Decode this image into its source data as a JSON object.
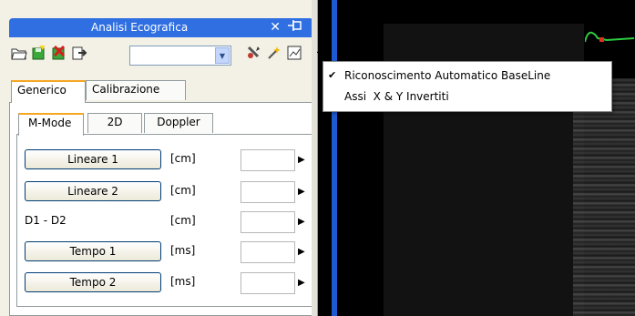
{
  "panel": {
    "title": "Analisi Ecografica",
    "close_glyph": "✕",
    "pin_glyph": "⊣▭"
  },
  "toolbar": {
    "icons": [
      "open-folder-icon",
      "save-green-icon",
      "delete-red-icon",
      "export-icon",
      "tools-icon",
      "wand-icon",
      "chart-icon"
    ],
    "combo_value": ""
  },
  "tabs": {
    "outer": [
      {
        "label": "Generico",
        "active": true
      },
      {
        "label": "Calibrazione",
        "active": false
      }
    ],
    "inner": [
      {
        "label": "M-Mode",
        "active": true
      },
      {
        "label": "2D",
        "active": false
      },
      {
        "label": "Doppler",
        "active": false
      }
    ]
  },
  "measurements": [
    {
      "label": "Lineare 1",
      "unit": "[cm]",
      "is_button": true,
      "value": ""
    },
    {
      "label": "Lineare 2",
      "unit": "[cm]",
      "is_button": true,
      "value": ""
    },
    {
      "label": "D1 - D2",
      "unit": "[cm]",
      "is_button": false,
      "value": ""
    },
    {
      "label": "Tempo 1",
      "unit": "[ms]",
      "is_button": true,
      "value": ""
    },
    {
      "label": "Tempo 2",
      "unit": "[ms]",
      "is_button": true,
      "value": ""
    }
  ],
  "menu": {
    "items": [
      {
        "label": "Riconoscimento Automatico BaseLine",
        "checked": true
      },
      {
        "label": "Assi  X & Y Invertiti",
        "checked": false
      }
    ]
  },
  "colors": {
    "title_blue": "#2f6fe1",
    "tab_accent": "#f5a623",
    "trace_green": "#2ecc40",
    "trace_red": "#e0301e"
  }
}
